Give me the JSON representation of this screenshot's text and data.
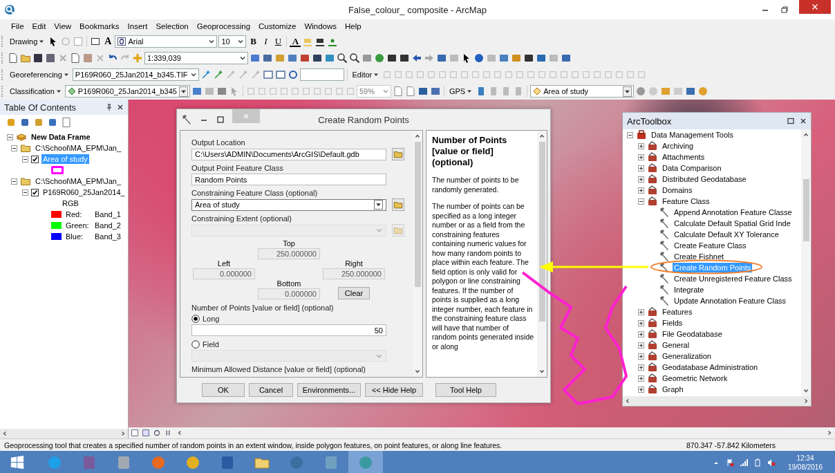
{
  "window": {
    "title": "False_colour_ composite - ArcMap"
  },
  "menu": [
    "File",
    "Edit",
    "View",
    "Bookmarks",
    "Insert",
    "Selection",
    "Geoprocessing",
    "Customize",
    "Windows",
    "Help"
  ],
  "drawing_toolbar": {
    "label": "Drawing",
    "text_tool": "A",
    "font": "Arial",
    "font_size": "10",
    "bold": "B",
    "italic": "I",
    "underline": "U",
    "font_color": "A"
  },
  "standard_toolbar": {
    "scale": "1:339,039"
  },
  "georeferencing_toolbar": {
    "label": "Georeferencing",
    "layer": "P169R060_25Jan2014_b345.TIF",
    "editor": "Editor"
  },
  "classification_toolbar": {
    "label": "Classification",
    "layer": "P169R060_25Jan2014_b345",
    "zoom": "59%",
    "gps": "GPS",
    "target_layer": "Area of study"
  },
  "toc": {
    "title": "Table Of Contents",
    "tree": [
      {
        "label": "New Data Frame",
        "expanded": true,
        "children": [
          {
            "label": "C:\\School\\MA_EPM\\Jan_",
            "expanded": true,
            "children": [
              {
                "kind": "layer",
                "label": "Area of study",
                "expanded": true,
                "checked": true,
                "selected": true,
                "color": "#ff00ff"
              }
            ]
          },
          {
            "label": "C:\\School\\MA_EPM\\Jan_",
            "expanded": true,
            "children": [
              {
                "kind": "raster",
                "label": "P169R060_25Jan2014_",
                "expanded": true,
                "checked": true,
                "selected": false,
                "renderer": "RGB",
                "bands": [
                  {
                    "channel": "Red:",
                    "band": "Band_1",
                    "color": "#ff0000"
                  },
                  {
                    "channel": "Green:",
                    "band": "Band_2",
                    "color": "#00ff00"
                  },
                  {
                    "channel": "Blue:",
                    "band": "Band_3",
                    "color": "#0000ff"
                  }
                ]
              }
            ]
          }
        ]
      }
    ]
  },
  "dialog": {
    "title": "Create Random Points",
    "output_location": {
      "label": "Output Location",
      "value": "C:\\Users\\ADMIN\\Documents\\ArcGIS\\Default.gdb"
    },
    "output_class": {
      "label": "Output Point Feature Class",
      "value": "Random Points"
    },
    "constraining_class": {
      "label": "Constraining Feature Class (optional)",
      "value": "Area of study"
    },
    "constraining_extent": {
      "label": "Constraining Extent (optional)",
      "disabled": true,
      "top": {
        "label": "Top",
        "value": "250.000000"
      },
      "left": {
        "label": "Left",
        "value": "0.000000"
      },
      "right": {
        "label": "Right",
        "value": "250.000000"
      },
      "bottom": {
        "label": "Bottom",
        "value": "0.000000"
      },
      "clear": "Clear"
    },
    "number_of_points": {
      "label": "Number of Points [value or field] (optional)",
      "options": [
        {
          "label": "Long",
          "selected": true
        },
        {
          "label": "Field",
          "selected": false
        }
      ],
      "value": "50",
      "field_disabled": true
    },
    "min_distance": {
      "label": "Minimum Allowed Distance [value or field] (optional)"
    },
    "help": {
      "title": "Number of Points [value or field] (optional)",
      "paragraphs": [
        "The number of points to be randomly generated.",
        "The number of points can be specified as a long integer number or as a field from the constraining features containing numeric values for how many random points to place within each feature. The field option is only valid for polygon or line constraining features. If the number of points is supplied as a long integer number, each feature in the constraining feature class will have that number of random points generated inside or along"
      ]
    },
    "buttons": [
      "OK",
      "Cancel",
      "Environments...",
      "<< Hide Help",
      "Tool Help"
    ]
  },
  "toolbox": {
    "title": "ArcToolbox",
    "tree": [
      {
        "label": "Data Management Tools",
        "expanded": true,
        "children": [
          {
            "label": "Archiving",
            "expanded": false
          },
          {
            "label": "Attachments",
            "expanded": false
          },
          {
            "label": "Data Comparison",
            "expanded": false
          },
          {
            "label": "Distributed Geodatabase",
            "expanded": false
          },
          {
            "label": "Domains",
            "expanded": false
          },
          {
            "label": "Feature Class",
            "expanded": true,
            "children": [
              {
                "label": "Append Annotation Feature Classe",
                "selected": false
              },
              {
                "label": "Calculate Default Spatial Grid Inde",
                "selected": false
              },
              {
                "label": "Calculate Default XY Tolerance",
                "selected": false
              },
              {
                "label": "Create Feature Class",
                "selected": false
              },
              {
                "label": "Create Fishnet",
                "selected": false
              },
              {
                "label": "Create Random Points",
                "selected": true
              },
              {
                "label": "Create Unregistered Feature Class",
                "selected": false
              },
              {
                "label": "Integrate",
                "selected": false
              },
              {
                "label": "Update Annotation Feature Class",
                "selected": false
              }
            ]
          },
          {
            "label": "Features",
            "expanded": false
          },
          {
            "label": "Fields",
            "expanded": false
          },
          {
            "label": "File Geodatabase",
            "expanded": false
          },
          {
            "label": "General",
            "expanded": false
          },
          {
            "label": "Generalization",
            "expanded": false
          },
          {
            "label": "Geodatabase Administration",
            "expanded": false
          },
          {
            "label": "Geometric Network",
            "expanded": false
          },
          {
            "label": "Graph",
            "expanded": false
          }
        ]
      }
    ]
  },
  "status_bar": {
    "message": "Geoprocessing tool that creates a specified number of random points in an extent window, inside polygon features, on point features, or along line features.",
    "coordinates": "870.347 -57.842 Kilometers"
  },
  "taskbar": {
    "time": "12:34",
    "date": "19/08/2016"
  }
}
